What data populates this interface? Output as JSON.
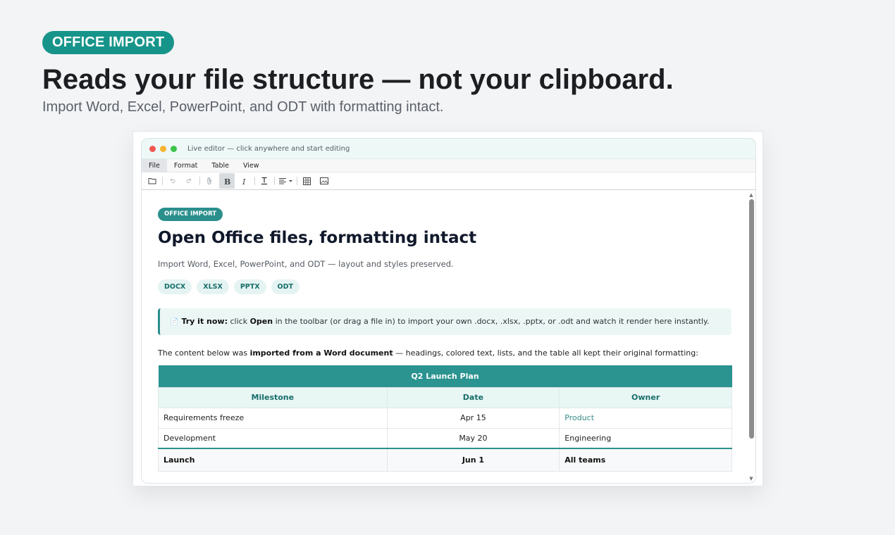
{
  "hero": {
    "badge": "OFFICE IMPORT",
    "title": "Reads your file structure — not your clipboard.",
    "subtitle": "Import Word, Excel, PowerPoint, and ODT with formatting intact."
  },
  "window": {
    "title": "Live editor — click anywhere and start editing",
    "menu": [
      "File",
      "Format",
      "Table",
      "View"
    ]
  },
  "toolbar_icons": [
    "open-file-icon",
    "undo-icon",
    "redo-icon",
    "attach-icon",
    "bold-icon",
    "italic-icon",
    "text-color-icon",
    "align-icon",
    "table-icon",
    "image-icon"
  ],
  "document": {
    "badge": "OFFICE IMPORT",
    "title": "Open Office files, formatting intact",
    "subtitle": "Import Word, Excel, PowerPoint, and ODT — layout and styles preserved.",
    "chips": [
      "DOCX",
      "XLSX",
      "PPTX",
      "ODT"
    ],
    "callout": {
      "lead": "Try it now:",
      "text1": " click ",
      "bold": "Open",
      "text2": " in the toolbar (or drag a file in) to import your own .docx, .xlsx, .pptx, or .odt and watch it render here instantly."
    },
    "intro": {
      "text1": "The content below was ",
      "bold": "imported from a Word document",
      "text2": " — headings, colored text, lists, and the table all kept their original formatting:"
    },
    "table": {
      "caption": "Q2 Launch Plan",
      "headers": [
        "Milestone",
        "Date",
        "Owner"
      ],
      "rows": [
        [
          "Requirements freeze",
          "Apr 15",
          "Product"
        ],
        [
          "Development",
          "May 20",
          "Engineering"
        ],
        [
          "Launch",
          "Jun 1",
          "All teams"
        ]
      ]
    }
  },
  "colors": {
    "accent": "#17948a",
    "doc_accent": "#2b8f8c"
  }
}
